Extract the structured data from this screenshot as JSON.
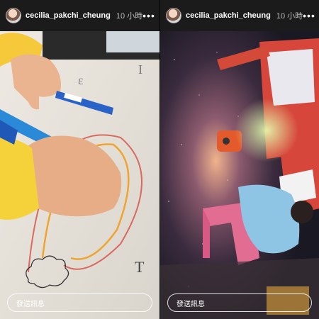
{
  "stories": [
    {
      "username": "cecilia_pakchi_cheung",
      "time": "10 小時",
      "more_icon": "more-icon",
      "reply_placeholder": "發送訊息",
      "progress": 1.0
    },
    {
      "username": "cecilia_pakchi_cheung",
      "time": "10 小時",
      "more_icon": "more-icon",
      "close_icon": "close-icon",
      "reply_placeholder": "發送訊息",
      "progress": 1.0
    }
  ],
  "colors": {
    "background": "#0b0b0b",
    "text": "#ffffff",
    "muted": "#bbbbbb"
  }
}
